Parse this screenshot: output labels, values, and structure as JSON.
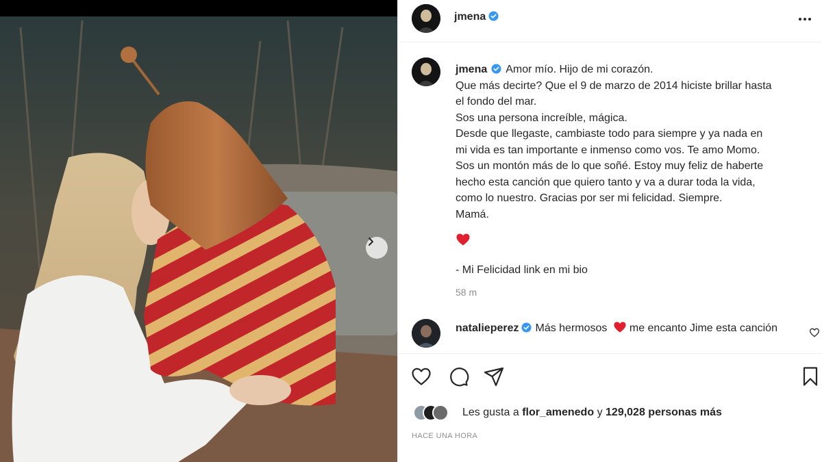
{
  "post": {
    "author": "jmena",
    "author_verified": true,
    "more_icon": "more-horizontal-icon"
  },
  "photo": {
    "carousel_next_icon": "chevron-right-icon"
  },
  "caption": {
    "author": "jmena",
    "lines": [
      "Amor mío. Hijo de mi corazón.",
      "Que más decirte? Que el 9 de marzo de 2014 hiciste brillar hasta",
      "el fondo del mar.",
      "Sos una persona increíble, mágica.",
      "Desde que llegaste, cambiaste todo para siempre y ya nada en",
      "mi vida es tan importante e inmenso como vos. Te amo Momo.",
      "Sos un montón más de lo que soñé. Estoy muy feliz de haberte",
      "hecho esta canción que quiero tanto y va a durar toda la vida,",
      "como lo nuestro. Gracias por ser mi felicidad. Siempre.",
      "Mamá."
    ],
    "heart_icon": "red-heart-icon",
    "link_line": "- Mi Felicidad link en mi bio",
    "time_ago": "58 m"
  },
  "comment": {
    "author": "natalieperez",
    "author_verified": true,
    "text_before": "Más hermosos",
    "text_after": "me encanto Jime esta canción",
    "like_icon": "heart-outline-icon"
  },
  "actions": {
    "like_icon": "heart-outline-icon",
    "comment_icon": "comment-icon",
    "share_icon": "paper-plane-icon",
    "save_icon": "bookmark-icon"
  },
  "likes": {
    "prefix": "Les gusta a",
    "user": "flor_amenedo",
    "connector": "y",
    "count_text": "129,028 personas más"
  },
  "posted_label": "HACE UNA HORA",
  "colors": {
    "verified_blue": "#3897f0",
    "heart_red": "#ed4956",
    "secondary_text": "#8e8e8e",
    "primary_text": "#262626"
  }
}
